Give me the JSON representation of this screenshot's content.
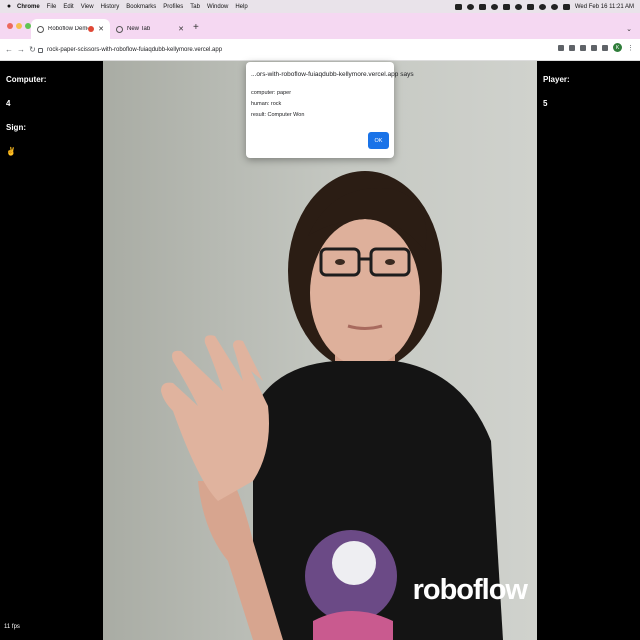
{
  "menubar": {
    "app": "Chrome",
    "items": [
      "File",
      "Edit",
      "View",
      "History",
      "Bookmarks",
      "Profiles",
      "Tab",
      "Window",
      "Help"
    ],
    "clock": "Wed Feb 16  11:21 AM"
  },
  "tabs": [
    {
      "title": "Roboflow Demo",
      "active": true
    },
    {
      "title": "New Tab",
      "active": false
    }
  ],
  "toolbar": {
    "url": "rock-paper-scissors-with-roboflow-fuiaqdubb-kellymore.vercel.app",
    "avatar_initial": "K"
  },
  "left_panel": {
    "computer_label": "Computer:",
    "computer_score": "4",
    "sign_label": "Sign:",
    "sign_value": "✌",
    "fps": "11 fps"
  },
  "right_panel": {
    "player_label": "Player:",
    "player_score": "5"
  },
  "video": {
    "watermark": "roboflow"
  },
  "dialog": {
    "title": "...ors-with-roboflow-fuiaqdubb-kellymore.vercel.app says",
    "lines": [
      "computer: paper",
      " human: rock",
      " result: Computer Won"
    ],
    "ok_label": "OK"
  },
  "colors": {
    "tabstrip": "#f5d8f2",
    "ok_button": "#1a73e8",
    "page_background": "#000000"
  }
}
